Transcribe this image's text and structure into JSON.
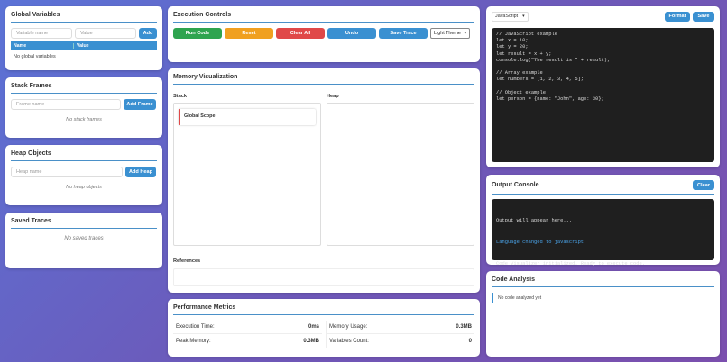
{
  "global_variables": {
    "title": "Global Variables",
    "name_placeholder": "Variable name",
    "value_placeholder": "Value",
    "add_label": "Add",
    "col_name": "Name",
    "col_value": "Value",
    "empty": "No global variables"
  },
  "stack_frames": {
    "title": "Stack Frames",
    "placeholder": "Frame name",
    "add_label": "Add Frame",
    "empty": "No stack frames"
  },
  "heap_objects": {
    "title": "Heap Objects",
    "placeholder": "Heap name",
    "add_label": "Add Heap",
    "empty": "No heap objects"
  },
  "saved_traces": {
    "title": "Saved Traces",
    "empty": "No saved traces"
  },
  "execution_controls": {
    "title": "Execution Controls",
    "run": "Run Code",
    "reset": "Reset",
    "clear_all": "Clear All",
    "undo": "Undo",
    "save_trace": "Save Trace",
    "theme": "Light Theme"
  },
  "memory": {
    "title": "Memory Visualization",
    "stack_label": "Stack",
    "heap_label": "Heap",
    "global_scope": "Global Scope",
    "references_label": "References"
  },
  "performance": {
    "title": "Performance Metrics",
    "exec_time_label": "Execution Time:",
    "exec_time_value": "0ms",
    "memory_usage_label": "Memory Usage:",
    "memory_usage_value": "0.3MB",
    "peak_memory_label": "Peak Memory:",
    "peak_memory_value": "0.3MB",
    "var_count_label": "Variables Count:",
    "var_count_value": "0"
  },
  "editor": {
    "language": "JavaScript",
    "format": "Format",
    "save": "Save",
    "code": "// JavaScript example\nlet x = 10;\nlet y = 20;\nlet result = x + y;\nconsole.log(\"The result is \" + result);\n\n// Array example\nlet numbers = [1, 2, 3, 4, 5];\n\n// Object example\nlet person = {name: \"John\", age: 30};"
  },
  "console": {
    "title": "Output Console",
    "clear": "Clear",
    "line1": "Output will appear here...",
    "line2": "Language changed to javascript",
    "line3": "Code Visualizer initialized. Ready to execute code."
  },
  "code_analysis": {
    "title": "Code Analysis",
    "empty": "No code analyzed yet"
  },
  "colors": {
    "accent": "#3a90d1",
    "run": "#2ea44f",
    "reset": "#f0a020",
    "clear_all": "#e04848",
    "scope_marker": "#e04848"
  }
}
